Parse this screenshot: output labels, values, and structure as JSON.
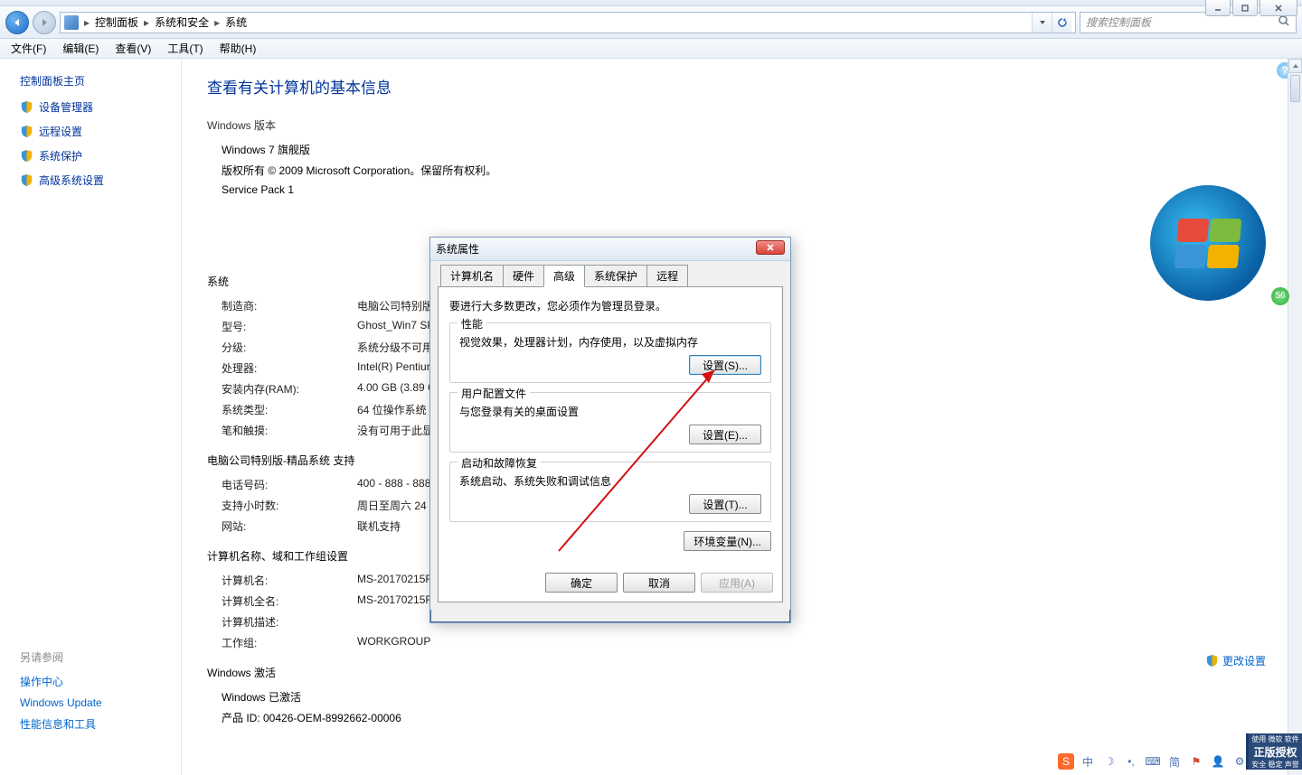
{
  "window_controls": {
    "min": "−",
    "max": "□",
    "close": "✕"
  },
  "breadcrumb": [
    "控制面板",
    "系统和安全",
    "系统"
  ],
  "search_placeholder": "搜索控制面板",
  "menubar": [
    "文件(F)",
    "编辑(E)",
    "查看(V)",
    "工具(T)",
    "帮助(H)"
  ],
  "sidebar": {
    "title": "控制面板主页",
    "links": [
      "设备管理器",
      "远程设置",
      "系统保护",
      "高级系统设置"
    ],
    "see_also_title": "另请参阅",
    "see_also": [
      "操作中心",
      "Windows Update",
      "性能信息和工具"
    ]
  },
  "content": {
    "h1": "查看有关计算机的基本信息",
    "edition_h": "Windows 版本",
    "edition_name": "Windows 7 旗舰版",
    "copyright": "版权所有 © 2009 Microsoft Corporation。保留所有权利。",
    "sp": "Service Pack 1",
    "system_h": "系统",
    "rows": {
      "manufacturer": {
        "k": "制造商:",
        "v": "电脑公司特别版"
      },
      "model": {
        "k": "型号:",
        "v": "Ghost_Win7 SP"
      },
      "rating": {
        "k": "分级:",
        "v": "系统分级不可用"
      },
      "processor": {
        "k": "处理器:",
        "v": "Intel(R) Pentiur"
      },
      "ram": {
        "k": "安装内存(RAM):",
        "v": "4.00 GB (3.89 G"
      },
      "systype": {
        "k": "系统类型:",
        "v": "64 位操作系统"
      },
      "pen": {
        "k": "笔和触摸:",
        "v": "没有可用于此显"
      }
    },
    "support_h": "电脑公司特别版-精品系统 支持",
    "support": {
      "phone": {
        "k": "电话号码:",
        "v": "400 - 888 - 888"
      },
      "hours": {
        "k": "支持小时数:",
        "v": "周日至周六  24"
      },
      "site": {
        "k": "网站:",
        "v": "联机支持"
      }
    },
    "name_h": "计算机名称、域和工作组设置",
    "names": {
      "cname": {
        "k": "计算机名:",
        "v": "MS-20170215F"
      },
      "fname": {
        "k": "计算机全名:",
        "v": "MS-20170215F"
      },
      "desc": {
        "k": "计算机描述:",
        "v": ""
      },
      "wg": {
        "k": "工作组:",
        "v": "WORKGROUP"
      }
    },
    "change_settings": "更改设置",
    "activation_h": "Windows 激活",
    "activation_status": "Windows 已激活",
    "product_id": "产品 ID: 00426-OEM-8992662-00006"
  },
  "dialog": {
    "title": "系统属性",
    "tabs": [
      "计算机名",
      "硬件",
      "高级",
      "系统保护",
      "远程"
    ],
    "active_tab": 2,
    "note": "要进行大多数更改，您必须作为管理员登录。",
    "perf": {
      "title": "性能",
      "desc": "视觉效果，处理器计划，内存使用，以及虚拟内存",
      "btn": "设置(S)..."
    },
    "profile": {
      "title": "用户配置文件",
      "desc": "与您登录有关的桌面设置",
      "btn": "设置(E)..."
    },
    "startup": {
      "title": "启动和故障恢复",
      "desc": "系统启动、系统失败和调试信息",
      "btn": "设置(T)..."
    },
    "env_btn": "环境变量(N)...",
    "ok": "确定",
    "cancel": "取消",
    "apply": "应用(A)"
  },
  "tray": {
    "items": [
      "中",
      "简"
    ],
    "unlock_badge": "56"
  },
  "activation_badge": {
    "l1": "使用 微软 软件",
    "l2": "正版授权",
    "l3": "安全 稳定 声誉"
  }
}
